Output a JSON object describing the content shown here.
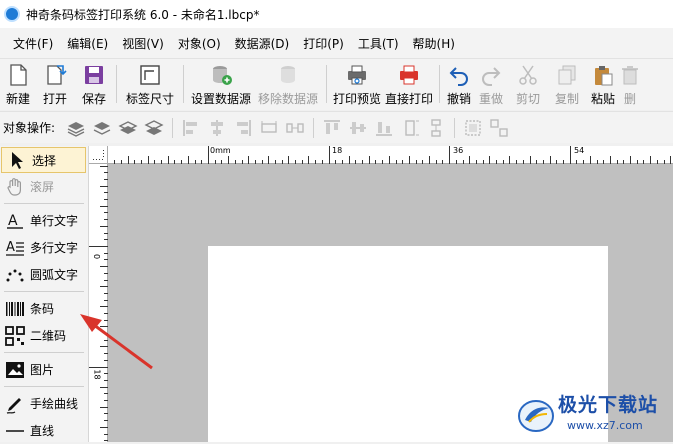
{
  "window": {
    "title": "神奇条码标签打印系统 6.0 - 未命名1.lbcp*"
  },
  "menu": [
    {
      "label": "文件(F)"
    },
    {
      "label": "编辑(E)"
    },
    {
      "label": "视图(V)"
    },
    {
      "label": "对象(O)"
    },
    {
      "label": "数据源(D)"
    },
    {
      "label": "打印(P)"
    },
    {
      "label": "工具(T)"
    },
    {
      "label": "帮助(H)"
    }
  ],
  "toolbar": {
    "new": "新建",
    "open": "打开",
    "save": "保存",
    "label_size": "标签尺寸",
    "set_datasource": "设置数据源",
    "remove_datasource": "移除数据源",
    "print_preview": "打印预览",
    "direct_print": "直接打印",
    "undo": "撤销",
    "redo": "重做",
    "cut": "剪切",
    "copy": "复制",
    "paste": "粘贴",
    "delete": "删"
  },
  "object_bar": {
    "label": "对象操作:"
  },
  "sidebar": {
    "select": "选择",
    "scroll": "滚屏",
    "single_text": "单行文字",
    "multi_text": "多行文字",
    "arc_text": "圆弧文字",
    "barcode": "条码",
    "qrcode": "二维码",
    "image": "图片",
    "freehand": "手绘曲线",
    "line": "直线"
  },
  "ruler": {
    "top_labels": [
      "0mm",
      "18",
      "36",
      "54"
    ],
    "left_labels": [
      "0",
      "18"
    ]
  },
  "watermark": {
    "name": "极光下载站",
    "url": "www.xz7.com"
  },
  "colors": {
    "accent_red": "#d9342b",
    "accent_blue": "#1e7bd6",
    "canvas_gray": "#c0c0c0",
    "selected_bg": "#fdf3d4"
  }
}
